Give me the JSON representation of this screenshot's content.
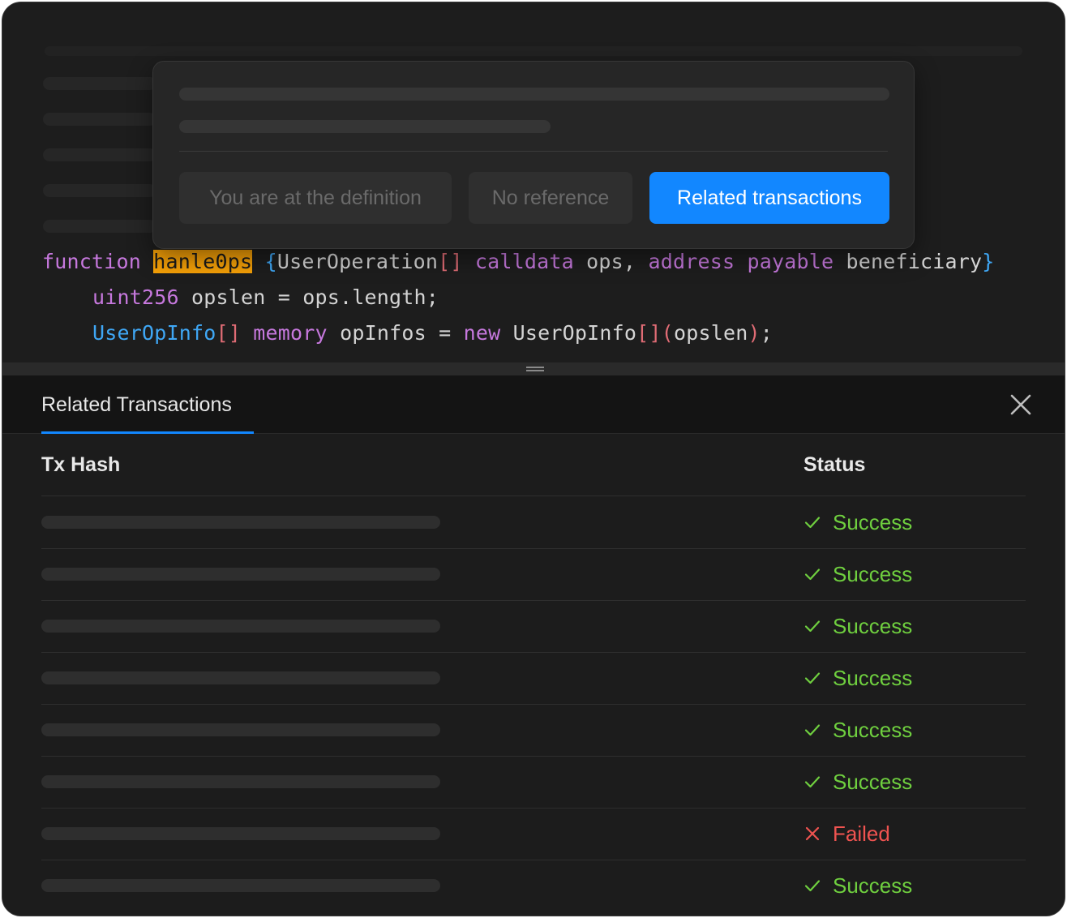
{
  "popup": {
    "buttons": [
      {
        "label": "You are at the definition",
        "state": "disabled"
      },
      {
        "label": "No reference",
        "state": "disabled"
      },
      {
        "label": "Related transactions",
        "state": "primary"
      }
    ]
  },
  "code": {
    "line1": {
      "kw_function": "function",
      "fn_name": "hanle0ps",
      "open_brace": "{",
      "type1": "UserOperation",
      "brackets1": "[]",
      "kw_calldata": "calldata",
      "arg1": "ops,",
      "kw_address": "address",
      "kw_payable": "payable",
      "arg2": "beneficiary",
      "close_brace": "}"
    },
    "line2": {
      "kw_uint": "uint256",
      "rest": "opslen = ops.length;"
    },
    "line3": {
      "type": "UserOpInfo",
      "brackets": "[]",
      "kw_memory": "memory",
      "mid": "opInfos =",
      "kw_new": "new",
      "ctor": "UserOpInfo",
      "brackets2": "[]",
      "paren_open": "(",
      "arg": "opslen",
      "paren_close": ")",
      "end": ";"
    }
  },
  "panel": {
    "tab_label": "Related Transactions",
    "col_hash": "Tx Hash",
    "col_status": "Status",
    "rows": [
      {
        "status": "Success"
      },
      {
        "status": "Success"
      },
      {
        "status": "Success"
      },
      {
        "status": "Success"
      },
      {
        "status": "Success"
      },
      {
        "status": "Success"
      },
      {
        "status": "Failed"
      },
      {
        "status": "Success"
      }
    ]
  },
  "icons": {
    "close": "close-icon",
    "success": "check-icon",
    "failed": "x-icon",
    "splitter": "drag-handle-icon"
  },
  "colors": {
    "accent": "#1287ff",
    "success": "#6fcf3f",
    "failed": "#ef5350",
    "highlight": "#f5a007"
  }
}
